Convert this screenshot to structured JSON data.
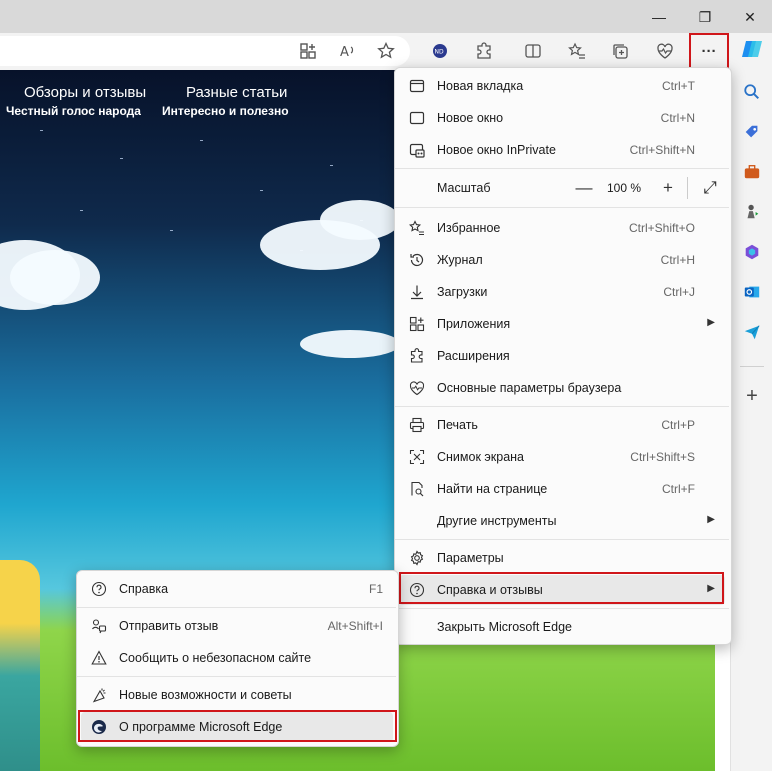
{
  "toolbar": {
    "icons": [
      "apps-icon",
      "read-aloud-icon",
      "favorite-star-icon",
      "extension-badge-icon",
      "extensions-icon",
      "split-screen-icon",
      "favorites-icon",
      "collections-icon",
      "browser-essentials-icon",
      "settings-more-icon"
    ],
    "more_label": "···"
  },
  "site": {
    "nav": [
      {
        "title": "Обзоры и отзывы",
        "sub": "Честный голос народа"
      },
      {
        "title": "Разные статьи",
        "sub": "Интересно и полезно"
      }
    ]
  },
  "menu": {
    "items": [
      {
        "label": "Новая вкладка",
        "shortcut": "Ctrl+T",
        "icon": "new-tab-icon"
      },
      {
        "label": "Новое окно",
        "shortcut": "Ctrl+N",
        "icon": "new-window-icon"
      },
      {
        "label": "Новое окно InPrivate",
        "shortcut": "Ctrl+Shift+N",
        "icon": "inprivate-icon"
      },
      {
        "label": "Масштаб",
        "zoom": "100 %"
      },
      {
        "label": "Избранное",
        "shortcut": "Ctrl+Shift+O",
        "icon": "favorites-icon"
      },
      {
        "label": "Журнал",
        "shortcut": "Ctrl+H",
        "icon": "history-icon"
      },
      {
        "label": "Загрузки",
        "shortcut": "Ctrl+J",
        "icon": "downloads-icon"
      },
      {
        "label": "Приложения",
        "arrow": "▶",
        "icon": "apps-icon"
      },
      {
        "label": "Расширения",
        "icon": "extensions-icon"
      },
      {
        "label": "Основные параметры браузера",
        "icon": "browser-essentials-icon"
      },
      {
        "label": "Печать",
        "shortcut": "Ctrl+P",
        "icon": "print-icon"
      },
      {
        "label": "Снимок экрана",
        "shortcut": "Ctrl+Shift+S",
        "icon": "screenshot-icon"
      },
      {
        "label": "Найти на странице",
        "shortcut": "Ctrl+F",
        "icon": "find-icon"
      },
      {
        "label": "Другие инструменты",
        "arrow": "▶"
      },
      {
        "label": "Параметры",
        "icon": "gear-icon"
      },
      {
        "label": "Справка и отзывы",
        "arrow": "▶",
        "icon": "help-icon"
      },
      {
        "label": "Закрыть Microsoft Edge"
      }
    ],
    "zoom_minus": "—",
    "zoom_plus": "+",
    "zoom_expand": "⤢"
  },
  "submenu": {
    "items": [
      {
        "label": "Справка",
        "shortcut": "F1",
        "icon": "help-icon"
      },
      {
        "label": "Отправить отзыв",
        "shortcut": "Alt+Shift+I",
        "icon": "feedback-icon"
      },
      {
        "label": "Сообщить о небезопасном сайте",
        "icon": "warning-icon"
      },
      {
        "label": "Новые возможности и советы",
        "icon": "sparkle-icon"
      },
      {
        "label": "О программе Microsoft Edge",
        "icon": "edge-logo-icon"
      }
    ]
  },
  "sidebar": {
    "icons": [
      "copilot-icon",
      "search-icon",
      "shopping-tag-icon",
      "tools-briefcase-icon",
      "games-icon",
      "microsoft365-icon",
      "outlook-icon",
      "drop-icon",
      "add-icon"
    ],
    "add_label": "+"
  },
  "window": {
    "minimize": "—",
    "restore": "❐",
    "close": "✕"
  },
  "colors": {
    "highlight": "#d0161a",
    "menu_bg": "#fbfbfb"
  }
}
